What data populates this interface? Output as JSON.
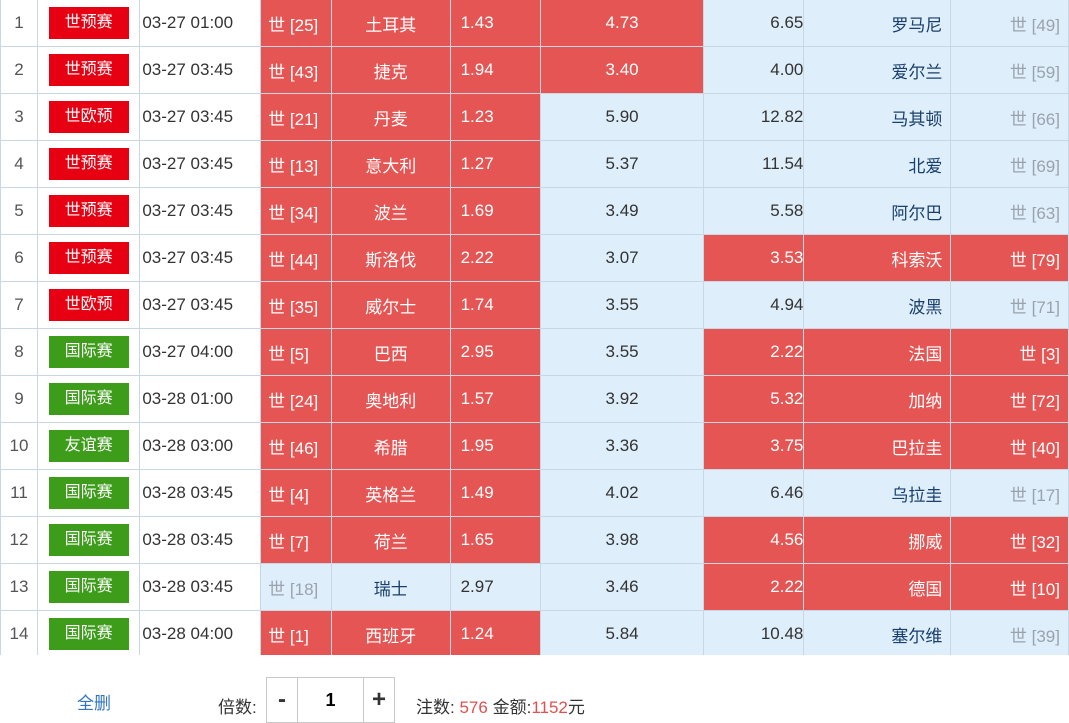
{
  "colors": {
    "selected": "#e45553",
    "unselected": "#deeefa",
    "tag_red": "#e60012",
    "tag_green": "#3d9c1a"
  },
  "rows": [
    {
      "no": "1",
      "tag": "世预赛",
      "tag_color": "red",
      "time": "03-27 01:00",
      "home_rank": "世 [25]",
      "home": "土耳其",
      "home_odds": "1.43",
      "draw_odds": "4.73",
      "away_odds": "6.65",
      "away": "罗马尼",
      "away_rank": "世 [49]",
      "sel": [
        true,
        true,
        false
      ]
    },
    {
      "no": "2",
      "tag": "世预赛",
      "tag_color": "red",
      "time": "03-27 03:45",
      "home_rank": "世 [43]",
      "home": "捷克",
      "home_odds": "1.94",
      "draw_odds": "3.40",
      "away_odds": "4.00",
      "away": "爱尔兰",
      "away_rank": "世 [59]",
      "sel": [
        true,
        true,
        false
      ]
    },
    {
      "no": "3",
      "tag": "世欧预",
      "tag_color": "red",
      "time": "03-27 03:45",
      "home_rank": "世 [21]",
      "home": "丹麦",
      "home_odds": "1.23",
      "draw_odds": "5.90",
      "away_odds": "12.82",
      "away": "马其顿",
      "away_rank": "世 [66]",
      "sel": [
        true,
        false,
        false
      ]
    },
    {
      "no": "4",
      "tag": "世预赛",
      "tag_color": "red",
      "time": "03-27 03:45",
      "home_rank": "世 [13]",
      "home": "意大利",
      "home_odds": "1.27",
      "draw_odds": "5.37",
      "away_odds": "11.54",
      "away": "北爱",
      "away_rank": "世 [69]",
      "sel": [
        true,
        false,
        false
      ]
    },
    {
      "no": "5",
      "tag": "世预赛",
      "tag_color": "red",
      "time": "03-27 03:45",
      "home_rank": "世 [34]",
      "home": "波兰",
      "home_odds": "1.69",
      "draw_odds": "3.49",
      "away_odds": "5.58",
      "away": "阿尔巴",
      "away_rank": "世 [63]",
      "sel": [
        true,
        false,
        false
      ]
    },
    {
      "no": "6",
      "tag": "世预赛",
      "tag_color": "red",
      "time": "03-27 03:45",
      "home_rank": "世 [44]",
      "home": "斯洛伐",
      "home_odds": "2.22",
      "draw_odds": "3.07",
      "away_odds": "3.53",
      "away": "科索沃",
      "away_rank": "世 [79]",
      "sel": [
        true,
        false,
        true
      ]
    },
    {
      "no": "7",
      "tag": "世欧预",
      "tag_color": "red",
      "time": "03-27 03:45",
      "home_rank": "世 [35]",
      "home": "威尔士",
      "home_odds": "1.74",
      "draw_odds": "3.55",
      "away_odds": "4.94",
      "away": "波黑",
      "away_rank": "世 [71]",
      "sel": [
        true,
        false,
        false
      ]
    },
    {
      "no": "8",
      "tag": "国际赛",
      "tag_color": "green",
      "time": "03-27 04:00",
      "home_rank": "世 [5]",
      "home": "巴西",
      "home_odds": "2.95",
      "draw_odds": "3.55",
      "away_odds": "2.22",
      "away": "法国",
      "away_rank": "世 [3]",
      "sel": [
        true,
        false,
        true
      ]
    },
    {
      "no": "9",
      "tag": "国际赛",
      "tag_color": "green",
      "time": "03-28 01:00",
      "home_rank": "世 [24]",
      "home": "奥地利",
      "home_odds": "1.57",
      "draw_odds": "3.92",
      "away_odds": "5.32",
      "away": "加纳",
      "away_rank": "世 [72]",
      "sel": [
        true,
        false,
        true
      ]
    },
    {
      "no": "10",
      "tag": "友谊赛",
      "tag_color": "green",
      "time": "03-28 03:00",
      "home_rank": "世 [46]",
      "home": "希腊",
      "home_odds": "1.95",
      "draw_odds": "3.36",
      "away_odds": "3.75",
      "away": "巴拉圭",
      "away_rank": "世 [40]",
      "sel": [
        true,
        false,
        true
      ]
    },
    {
      "no": "11",
      "tag": "国际赛",
      "tag_color": "green",
      "time": "03-28 03:45",
      "home_rank": "世 [4]",
      "home": "英格兰",
      "home_odds": "1.49",
      "draw_odds": "4.02",
      "away_odds": "6.46",
      "away": "乌拉圭",
      "away_rank": "世 [17]",
      "sel": [
        true,
        false,
        false
      ]
    },
    {
      "no": "12",
      "tag": "国际赛",
      "tag_color": "green",
      "time": "03-28 03:45",
      "home_rank": "世 [7]",
      "home": "荷兰",
      "home_odds": "1.65",
      "draw_odds": "3.98",
      "away_odds": "4.56",
      "away": "挪威",
      "away_rank": "世 [32]",
      "sel": [
        true,
        false,
        true
      ]
    },
    {
      "no": "13",
      "tag": "国际赛",
      "tag_color": "green",
      "time": "03-28 03:45",
      "home_rank": "世 [18]",
      "home": "瑞士",
      "home_odds": "2.97",
      "draw_odds": "3.46",
      "away_odds": "2.22",
      "away": "德国",
      "away_rank": "世 [10]",
      "sel": [
        false,
        false,
        true
      ]
    },
    {
      "no": "14",
      "tag": "国际赛",
      "tag_color": "green",
      "time": "03-28 04:00",
      "home_rank": "世 [1]",
      "home": "西班牙",
      "home_odds": "1.24",
      "draw_odds": "5.84",
      "away_odds": "10.48",
      "away": "塞尔维",
      "away_rank": "世 [39]",
      "sel": [
        true,
        false,
        false
      ]
    }
  ],
  "footer": {
    "clear_all": "全删",
    "multiplier_label": "倍数:",
    "minus": "-",
    "plus": "+",
    "multiplier_value": "1",
    "bets_label": "注数:",
    "bets_value": "576",
    "amount_label": "金额:",
    "amount_value": "1152",
    "currency": "元"
  }
}
